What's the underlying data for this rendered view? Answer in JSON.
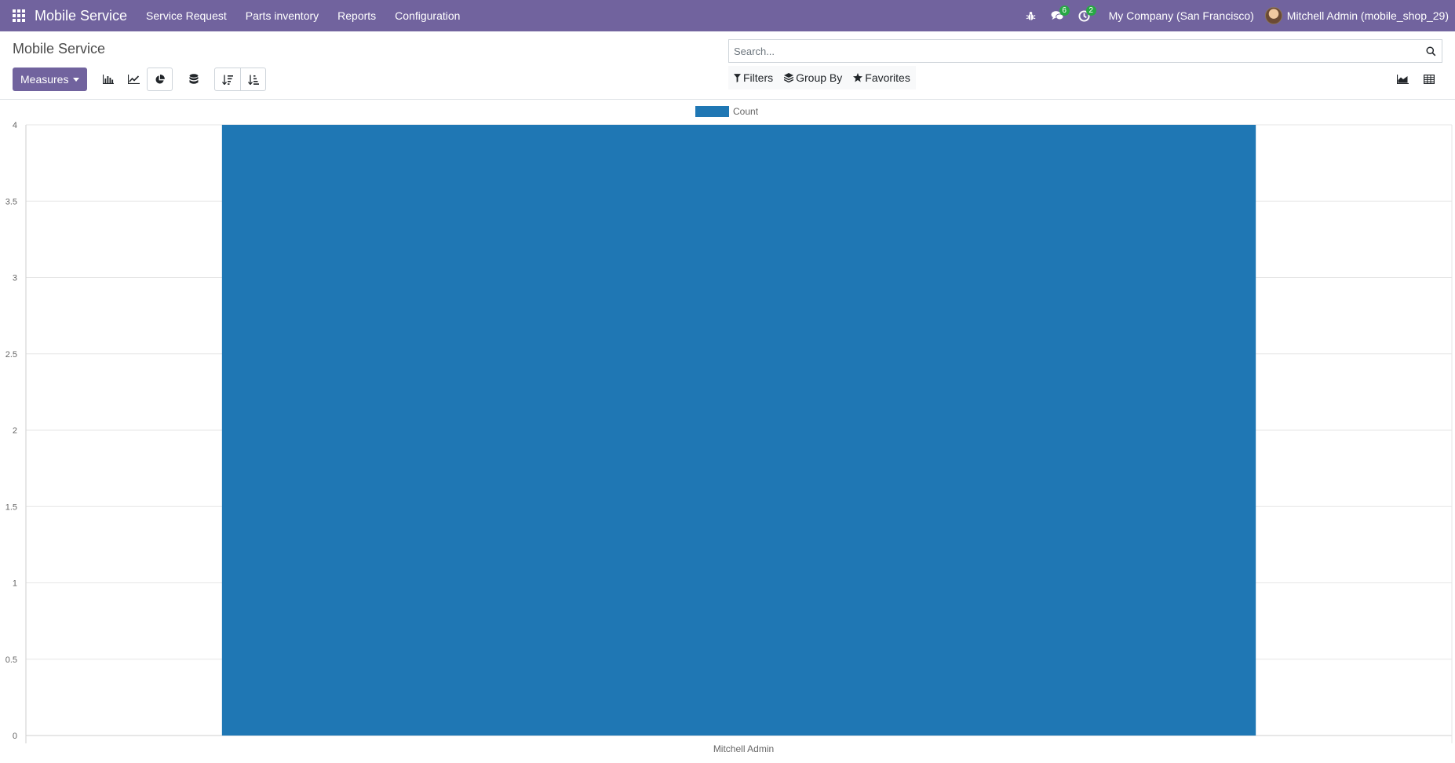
{
  "navbar": {
    "apps_icon": "apps-grid-icon",
    "brand": "Mobile Service",
    "menu": [
      {
        "label": "Service Request"
      },
      {
        "label": "Parts inventory"
      },
      {
        "label": "Reports"
      },
      {
        "label": "Configuration"
      }
    ],
    "debug_icon": "bug-icon",
    "messages_icon": "chat-icon",
    "messages_count": "6",
    "activities_icon": "clock-icon",
    "activities_count": "2",
    "company": "My Company (San Francisco)",
    "user": "Mitchell Admin (mobile_shop_29)",
    "accent_color": "#71639e"
  },
  "control_panel": {
    "breadcrumb": "Mobile Service",
    "measures_label": "Measures",
    "search": {
      "placeholder": "Search...",
      "value": ""
    },
    "filters_label": "Filters",
    "groupby_label": "Group By",
    "favorites_label": "Favorites",
    "chart_mode_icons": [
      "bar-chart-icon",
      "line-chart-icon",
      "pie-chart-icon"
    ],
    "stacked_icon": "database-icon",
    "sort_icons": [
      "sort-descending-icon",
      "sort-ascending-icon"
    ],
    "view_icons": [
      "area-chart-icon",
      "table-icon"
    ]
  },
  "chart_data": {
    "type": "bar",
    "categories": [
      "Mitchell Admin"
    ],
    "series": [
      {
        "name": "Count",
        "values": [
          4
        ],
        "color": "#1f77b4"
      }
    ],
    "yticks": [
      "0",
      "0.5",
      "1",
      "1.5",
      "2",
      "2.5",
      "3",
      "3.5",
      "4"
    ],
    "ylim": [
      0,
      4
    ],
    "grid": true,
    "legend": "top-center"
  }
}
